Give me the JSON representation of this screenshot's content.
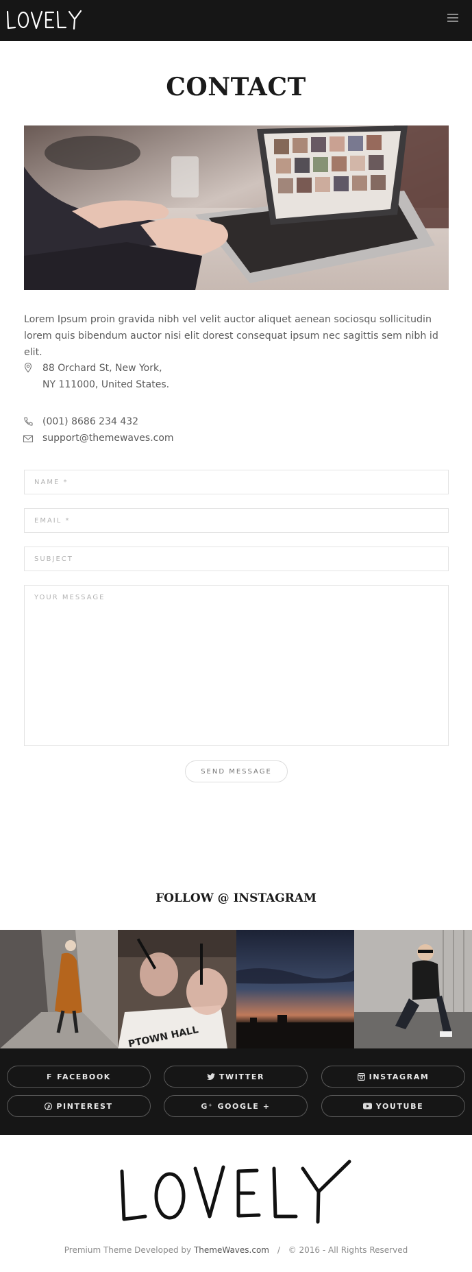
{
  "header": {
    "brand": "LOVELY",
    "menu_icon": "hamburger-menu-icon"
  },
  "page": {
    "title": "CONTACT"
  },
  "intro_text": "Lorem Ipsum proin gravida nibh vel velit auctor aliquet aenean sociosqu sollicitudin lorem quis bibendum auctor nisi elit dorest consequat ipsum nec sagittis sem nibh id elit.",
  "contact": {
    "address_line1": "88 Orchard St, New York,",
    "address_line2": "NY 111000, United States.",
    "phone": "(001) 8686 234 432",
    "email": "support@themewaves.com"
  },
  "form": {
    "name_placeholder": "NAME *",
    "email_placeholder": "EMAIL *",
    "subject_placeholder": "SUBJECT",
    "message_placeholder": "YOUR MESSAGE",
    "send_label": "SEND MESSAGE"
  },
  "instagram": {
    "title": "FOLLOW @ INSTAGRAM"
  },
  "social": [
    {
      "label": "FACEBOOK",
      "icon": "facebook-icon"
    },
    {
      "label": "TWITTER",
      "icon": "twitter-icon"
    },
    {
      "label": "INSTAGRAM",
      "icon": "instagram-icon"
    },
    {
      "label": "PINTEREST",
      "icon": "pinterest-icon"
    },
    {
      "label": "GOOGLE +",
      "icon": "google-plus-icon"
    },
    {
      "label": "YOUTUBE",
      "icon": "youtube-icon"
    }
  ],
  "footer": {
    "brand": "LOVELY",
    "credit_prefix": "Premium Theme Developed by",
    "credit_name": "ThemeWaves.com",
    "separator": "/",
    "copyright": "© 2016 - All Rights Reserved"
  },
  "colors": {
    "dark_bar": "#161616",
    "text": "#5b5b5b",
    "border": "#e3e3e3"
  }
}
